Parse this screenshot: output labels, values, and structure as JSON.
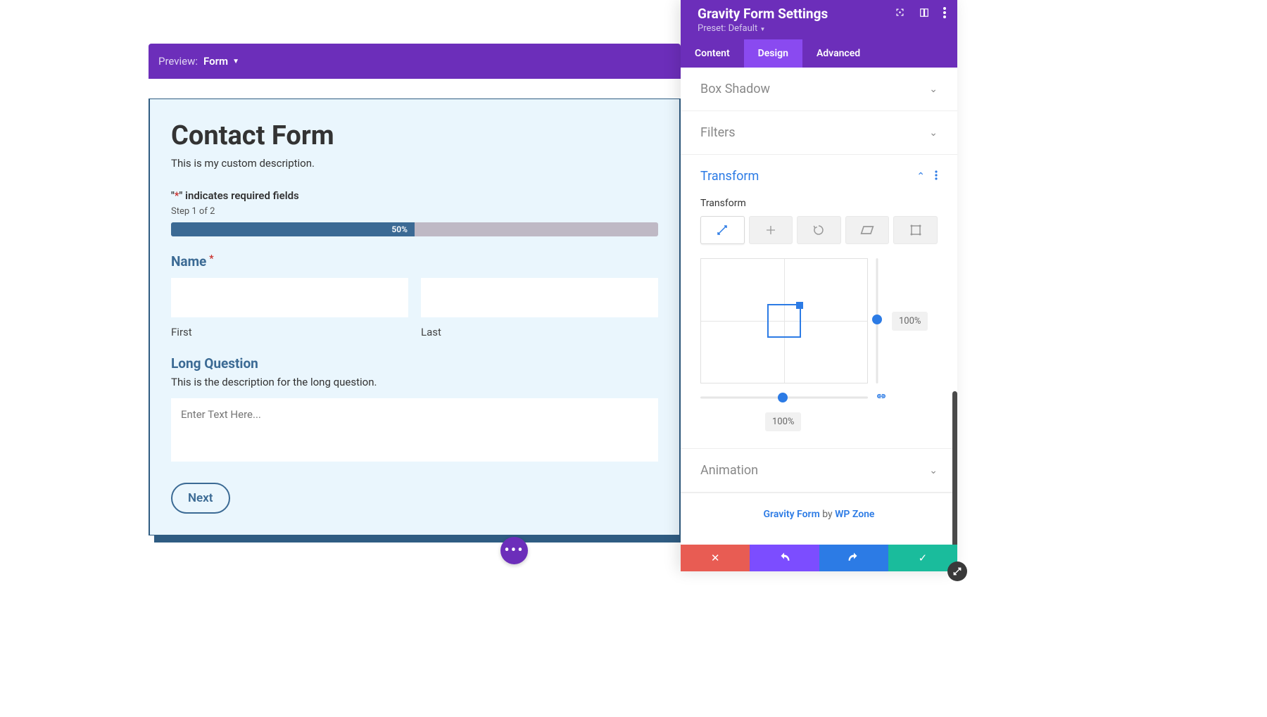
{
  "preview": {
    "label": "Preview:",
    "form": "Form"
  },
  "form": {
    "title": "Contact Form",
    "description": "This is my custom description.",
    "required_note_prefix": "\"",
    "required_star": "*",
    "required_note_suffix": "\" indicates required fields",
    "step_label": "Step 1 of 2",
    "progress": "50%",
    "name_label": "Name",
    "first_label": "First",
    "last_label": "Last",
    "long_label": "Long Question",
    "long_desc": "This is the description for the long question.",
    "textarea_placeholder": "Enter Text Here...",
    "next": "Next"
  },
  "panel": {
    "title": "Gravity Form Settings",
    "preset": "Preset: Default",
    "tabs": {
      "content": "Content",
      "design": "Design",
      "advanced": "Advanced"
    },
    "sections": {
      "box_shadow": "Box Shadow",
      "filters": "Filters",
      "transform": "Transform",
      "animation": "Animation"
    },
    "transform_label": "Transform",
    "vslider_value": "100%",
    "hslider_value": "100%",
    "footer_link1": "Gravity Form",
    "footer_by": " by ",
    "footer_link2": "WP Zone"
  }
}
